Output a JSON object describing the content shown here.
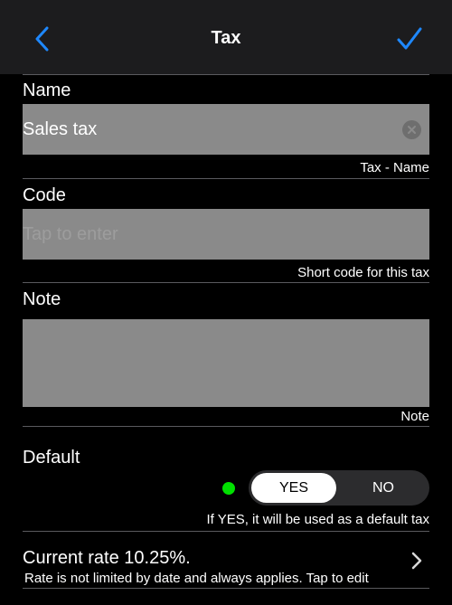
{
  "colors": {
    "accent": "#1e88ff",
    "navbar_bg": "#1c1c1e",
    "field_bg": "#8a8a8a",
    "status_dot": "#00e000"
  },
  "navbar": {
    "back_icon": "chevron-left-icon",
    "title": "Tax",
    "done_icon": "checkmark-icon"
  },
  "form": {
    "name": {
      "label": "Name",
      "value": "Sales tax",
      "hint": "Tax - Name",
      "clear_icon": "clear-x-icon"
    },
    "code": {
      "label": "Code",
      "value": "",
      "placeholder": "Tap to enter",
      "hint": "Short code for this tax"
    },
    "note": {
      "label": "Note",
      "value": "",
      "hint": "Note"
    },
    "default": {
      "label": "Default",
      "options": [
        "YES",
        "NO"
      ],
      "selected": "YES",
      "hint": "If YES, it will be used as a default tax"
    },
    "rate": {
      "title": "Current rate 10.25%.",
      "subtitle": "Rate is not limited by date and always applies. Tap to edit",
      "icon": "chevron-right-icon"
    }
  }
}
